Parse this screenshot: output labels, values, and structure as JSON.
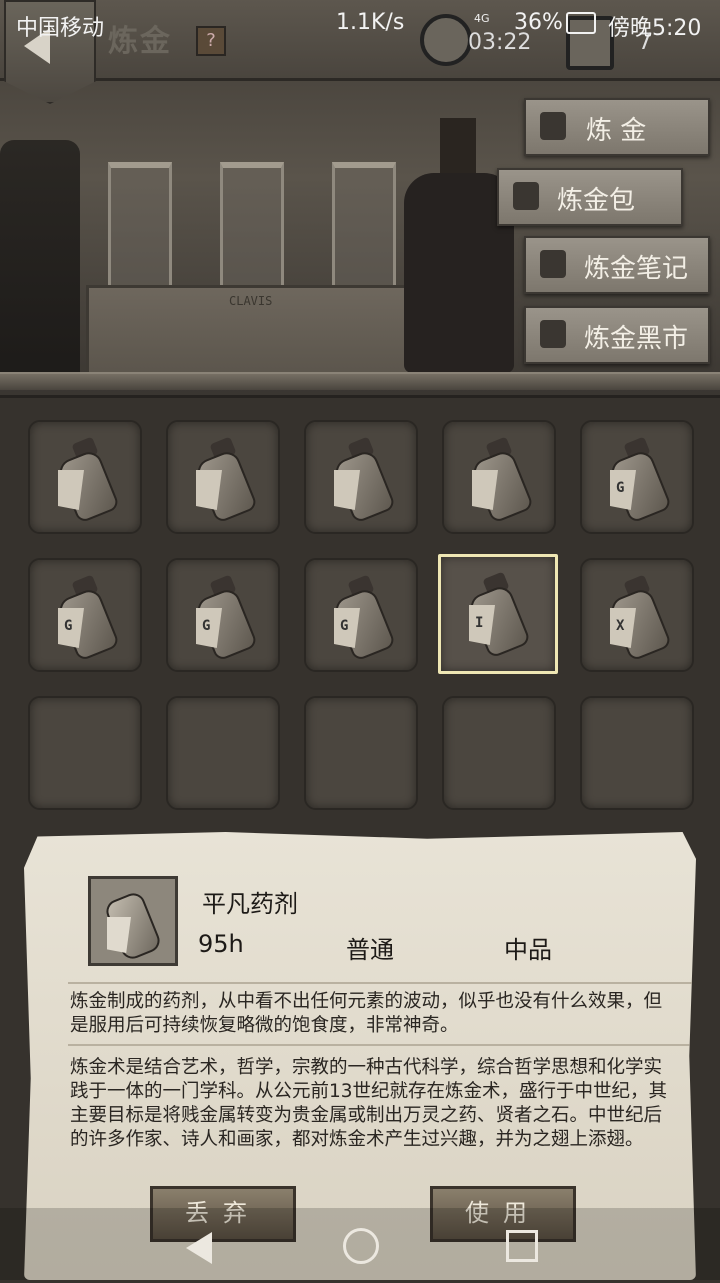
{
  "status_bar": {
    "carrier": "中国移动",
    "speed": "1.1K/s",
    "network": "4G",
    "battery": "36%",
    "time": "傍晚5:20"
  },
  "header": {
    "title": "炼金",
    "help_label": "?",
    "timer": "03:22",
    "counter": "7"
  },
  "scene": {
    "crate_label": "CLAVIS"
  },
  "side_menu": {
    "items": [
      {
        "label": "炼 金",
        "icon": "cauldron-icon"
      },
      {
        "label": "炼金包",
        "icon": "backpack-icon"
      },
      {
        "label": "炼金笔记",
        "icon": "book-icon"
      },
      {
        "label": "炼金黑市",
        "icon": "shop-icon"
      }
    ]
  },
  "inventory": {
    "slots": [
      {
        "rune": "",
        "filled": true
      },
      {
        "rune": "",
        "filled": true
      },
      {
        "rune": "",
        "filled": true
      },
      {
        "rune": "",
        "filled": true
      },
      {
        "rune": "G",
        "filled": true
      },
      {
        "rune": "G",
        "filled": true
      },
      {
        "rune": "G",
        "filled": true
      },
      {
        "rune": "G",
        "filled": true
      },
      {
        "rune": "I",
        "filled": true,
        "selected": true
      },
      {
        "rune": "X",
        "filled": true
      },
      {
        "filled": false
      },
      {
        "filled": false
      },
      {
        "filled": false
      },
      {
        "filled": false
      },
      {
        "filled": false
      }
    ]
  },
  "detail": {
    "name": "平凡药剂",
    "duration": "95h",
    "rarity": "普通",
    "quality": "中品",
    "description": "炼金制成的药剂，从中看不出任何元素的波动，似乎也没有什么效果，但是服用后可持续恢复略微的饱食度，非常神奇。",
    "lore": "炼金术是结合艺术，哲学，宗教的一种古代科学，综合哲学思想和化学实践于一体的一门学科。从公元前13世纪就存在炼金术，盛行于中世纪，其主要目标是将贱金属转变为贵金属或制出万灵之药、贤者之石。中世纪后的许多作家、诗人和画家，都对炼金术产生过兴趣，并为之翅上添翅。",
    "discard_label": "丢弃",
    "use_label": "使用"
  }
}
